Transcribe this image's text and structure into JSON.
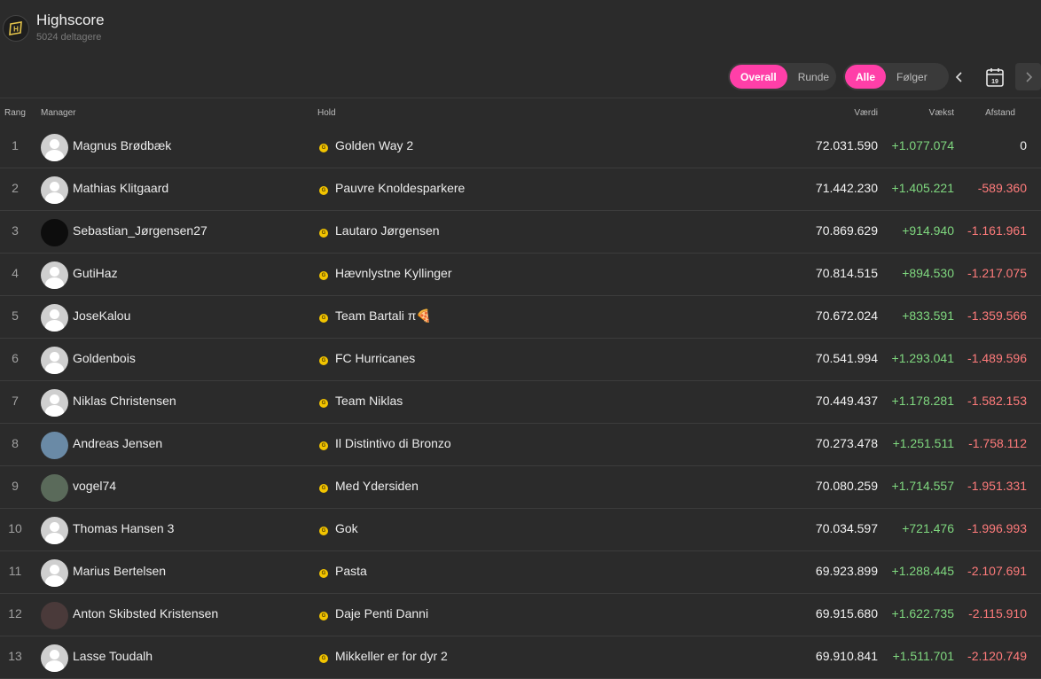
{
  "header": {
    "title": "Highscore",
    "subtitle": "5024 deltagere",
    "logo_icon": "shield-h-logo"
  },
  "toolbar": {
    "scope": [
      {
        "label": "Overall",
        "active": true
      },
      {
        "label": "Runde",
        "active": false
      }
    ],
    "filter": [
      {
        "label": "Alle",
        "active": true
      },
      {
        "label": "Følger",
        "active": false
      }
    ],
    "calendar_day": "19",
    "accent": "#ff3fa8"
  },
  "columns": {
    "rank": "Rang",
    "manager": "Manager",
    "team": "Hold",
    "value": "Værdi",
    "growth": "Vækst",
    "distance": "Afstand"
  },
  "rows": [
    {
      "rank": "1",
      "manager": "Magnus Brødbæk",
      "team": "Golden Way 2",
      "value": "72.031.590",
      "growth": "+1.077.074",
      "distance": "0"
    },
    {
      "rank": "2",
      "manager": "Mathias Klitgaard",
      "team": "Pauvre Knoldesparkere",
      "value": "71.442.230",
      "growth": "+1.405.221",
      "distance": "-589.360"
    },
    {
      "rank": "3",
      "manager": "Sebastian_Jørgensen27",
      "team": "Lautaro Jørgensen",
      "value": "70.869.629",
      "growth": "+914.940",
      "distance": "-1.161.961"
    },
    {
      "rank": "4",
      "manager": "GutiHaz",
      "team": "Hævnlystne Kyllinger",
      "value": "70.814.515",
      "growth": "+894.530",
      "distance": "-1.217.075"
    },
    {
      "rank": "5",
      "manager": "JoseKalou",
      "team": "Team Bartali π🍕",
      "value": "70.672.024",
      "growth": "+833.591",
      "distance": "-1.359.566"
    },
    {
      "rank": "6",
      "manager": "Goldenbois",
      "team": "FC Hurricanes",
      "value": "70.541.994",
      "growth": "+1.293.041",
      "distance": "-1.489.596"
    },
    {
      "rank": "7",
      "manager": "Niklas Christensen",
      "team": "Team Niklas",
      "value": "70.449.437",
      "growth": "+1.178.281",
      "distance": "-1.582.153"
    },
    {
      "rank": "8",
      "manager": "Andreas Jensen",
      "team": "Il Distintivo di Bronzo",
      "value": "70.273.478",
      "growth": "+1.251.511",
      "distance": "-1.758.112"
    },
    {
      "rank": "9",
      "manager": "vogel74",
      "team": "Med Ydersiden",
      "value": "70.080.259",
      "growth": "+1.714.557",
      "distance": "-1.951.331"
    },
    {
      "rank": "10",
      "manager": "Thomas Hansen 3",
      "team": "Gok",
      "value": "70.034.597",
      "growth": "+721.476",
      "distance": "-1.996.993"
    },
    {
      "rank": "11",
      "manager": "Marius Bertelsen",
      "team": "Pasta",
      "value": "69.923.899",
      "growth": "+1.288.445",
      "distance": "-2.107.691"
    },
    {
      "rank": "12",
      "manager": "Anton Skibsted Kristensen",
      "team": "Daje Penti Danni",
      "value": "69.915.680",
      "growth": "+1.622.735",
      "distance": "-2.115.910"
    },
    {
      "rank": "13",
      "manager": "Lasse Toudalh",
      "team": "Mikkeller er for dyr 2",
      "value": "69.910.841",
      "growth": "+1.511.701",
      "distance": "-2.120.749"
    }
  ],
  "avatar_styles": {
    "3": "#0d0d0d",
    "8": "#6a8aa6",
    "9": "#5a6a5a",
    "12": "#4a3a3a"
  }
}
